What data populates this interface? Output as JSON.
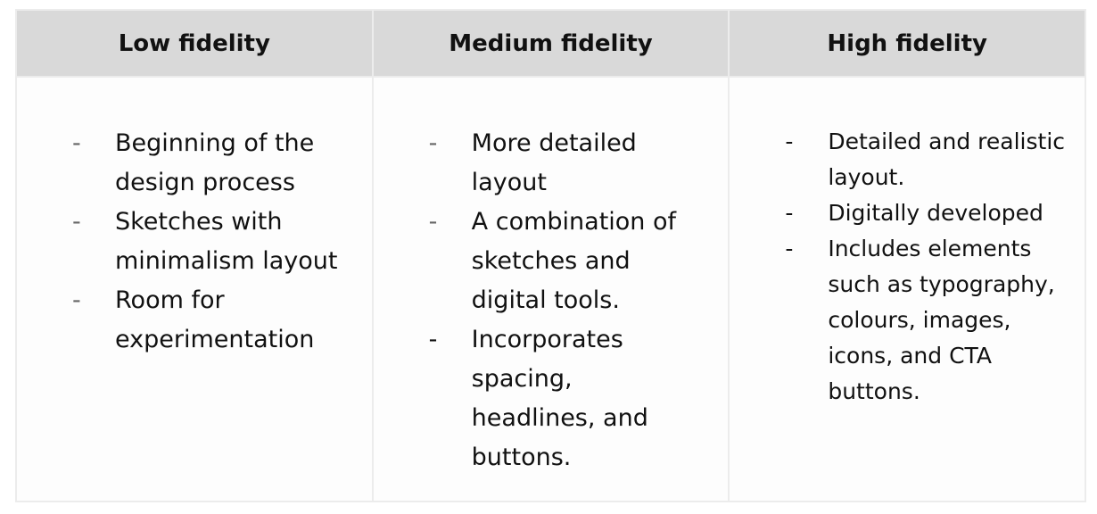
{
  "table": {
    "columns": [
      {
        "heading": "Low fidelity",
        "items": [
          "Beginning of the design process",
          "Sketches with minimalism layout",
          "Room for experimentation"
        ]
      },
      {
        "heading": "Medium fidelity",
        "items": [
          "More detailed layout",
          "A combination of sketches and digital tools.",
          "Incorporates spacing, headlines, and buttons."
        ]
      },
      {
        "heading": "High fidelity",
        "items": [
          "Detailed and realistic layout.",
          "Digitally developed",
          "Includes elements such as typography, colours, images, icons, and CTA buttons."
        ]
      }
    ],
    "bullet_marker": "-"
  }
}
